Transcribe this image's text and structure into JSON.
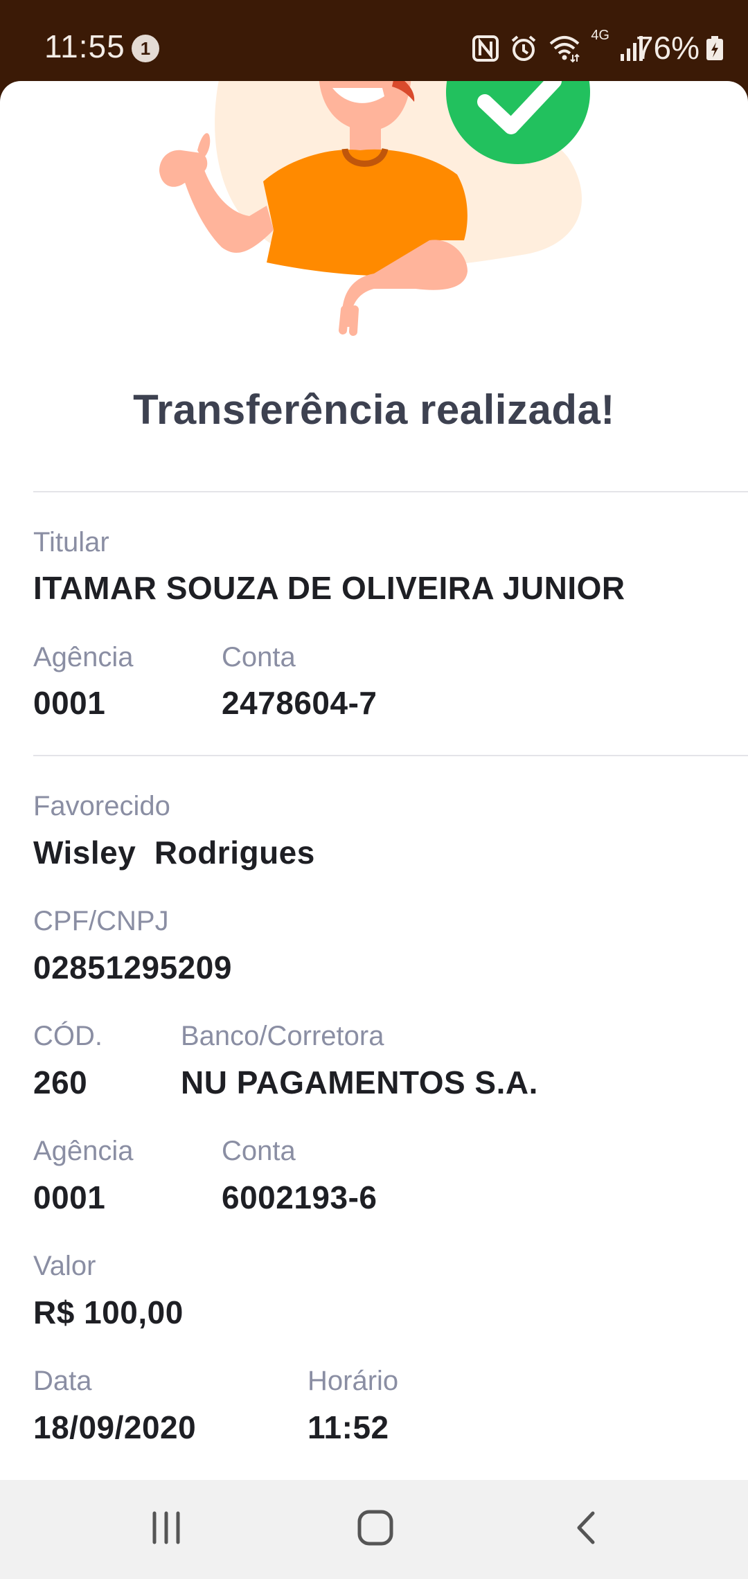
{
  "status_bar": {
    "time": "11:55",
    "notification_count": "1",
    "network_type": "4G",
    "battery_percent": "76%",
    "icons": [
      "nfc-icon",
      "alarm-icon",
      "wifi-icon",
      "signal-icon",
      "battery-charging-icon"
    ]
  },
  "colors": {
    "status_bar": "#3b1a06",
    "shirt": "#ff8a00",
    "success": "#22c15e",
    "title": "#3d4150",
    "label": "#8a8ea3",
    "value": "#1e1f24"
  },
  "title": "Transferência realizada!",
  "origin": {
    "holder_label": "Titular",
    "holder_value": "ITAMAR SOUZA DE OLIVEIRA JUNIOR",
    "branch_label": "Agência",
    "branch_value": "0001",
    "account_label": "Conta",
    "account_value": "2478604-7"
  },
  "recipient": {
    "name_label": "Favorecido",
    "name_value": "Wisley  Rodrigues",
    "doc_label": "CPF/CNPJ",
    "doc_value": "02851295209",
    "code_label": "CÓD.",
    "code_value": "260",
    "bank_label": "Banco/Corretora",
    "bank_value": "NU PAGAMENTOS S.A.",
    "branch_label": "Agência",
    "branch_value": "0001",
    "account_label": "Conta",
    "account_value": "6002193-6",
    "amount_label": "Valor",
    "amount_value": "R$ 100,00",
    "date_label": "Data",
    "date_value": "18/09/2020",
    "time_label": "Horário",
    "time_value": "11:52"
  },
  "nav": {
    "recents": "recent-apps-icon",
    "home": "home-icon",
    "back": "back-icon"
  }
}
